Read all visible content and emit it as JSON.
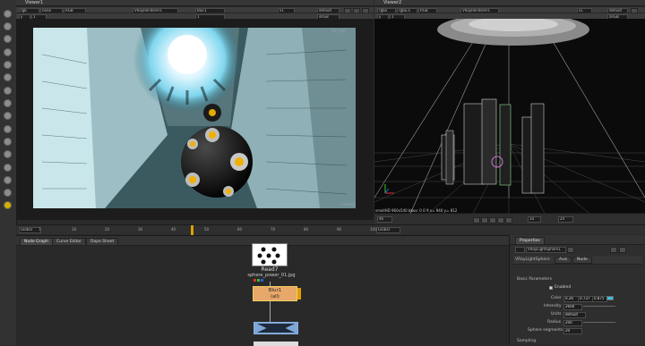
{
  "viewer1": {
    "title": "Viewer1",
    "channels": "rgb",
    "alpha": "none",
    "display": "RGB",
    "input_a": "VRayRenderer1",
    "input_b": "Blur1",
    "zoom": "x1",
    "lut": "default",
    "frame_field": "y",
    "frame_value": "1",
    "colorspace": "sRGB",
    "format_tag": "HD_540",
    "info_tag": "smallHD"
  },
  "viewer2": {
    "title": "Viewer2",
    "channels": "rgba",
    "alpha": "rgba.a",
    "display": "RGB",
    "input_a": "VRayRenderer1",
    "zoom": "x1",
    "lut": "default",
    "frame_field": "y",
    "frame_value": "1",
    "colorspace": "sRGB",
    "status": "smallHD 960x540 bbox: 0 0 9 x= 940 y= 812"
  },
  "timeline": {
    "frame": "46",
    "scope": "Global",
    "ticks": [
      "1",
      "10",
      "20",
      "30",
      "40",
      "50",
      "60",
      "70",
      "80",
      "90",
      "100"
    ],
    "marker_frame": 46,
    "playback_count": "10",
    "playback_step": "24"
  },
  "node_graph": {
    "tabs": [
      "Node Graph",
      "Curve Editor",
      "Dope Sheet"
    ],
    "read_node": "Read7",
    "read_file": "sphere_power_01.jpg",
    "blur_node": "Blur1",
    "blur_channels": "(all)"
  },
  "properties": {
    "panel_title": "Properties",
    "node_name": "VRayLightSphere1",
    "node_class": "VRayLightSphere",
    "tabs": [
      "Axis",
      "Node"
    ],
    "section_basic": "Basic Parameters",
    "enabled_label": "Enabled",
    "color_label": "Color",
    "color_values": [
      "0.26",
      "0.737",
      "0.875",
      "1"
    ],
    "intensity_label": "Intensity",
    "intensity_value": "2600",
    "units_label": "Units",
    "units_value": "default",
    "radius_label": "Radius",
    "radius_value": "200",
    "segments_label": "Sphere segments",
    "segments_value": "20",
    "section_sampling": "Sampling"
  }
}
